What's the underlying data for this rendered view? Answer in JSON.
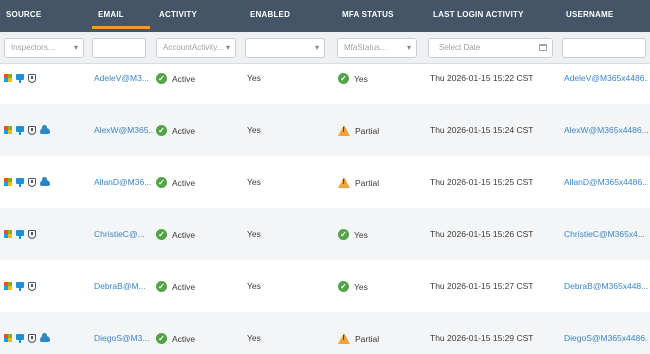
{
  "columns": {
    "source": "SOURCE",
    "email": "EMAIL",
    "activity": "ACTIVITY",
    "enabled": "ENABLED",
    "mfa": "MFA STATUS",
    "last_login": "LAST LOGIN ACTIVITY",
    "username": "USERNAME"
  },
  "filters": {
    "source": "Inspectors...",
    "email": "",
    "activity": "AccountActivity...",
    "enabled": "",
    "mfa": "MfaStatus...",
    "date": "Select Date",
    "username": ""
  },
  "colors": {
    "header_bg": "#435566",
    "active_tab": "#f39a2b",
    "link": "#3a86c8",
    "ok": "#52a447",
    "warn": "#f2a33a"
  },
  "rows": [
    {
      "icons": [
        "windows-icon",
        "monitor-icon",
        "shield-icon"
      ],
      "email": "AdeleV@M3...",
      "activity": "Active",
      "enabled": "Yes",
      "mfa": "Yes",
      "mfa_state": "ok",
      "last_login": "Thu 2026-01-15 15:22 CST",
      "username": "AdeleV@M365x4486..."
    },
    {
      "icons": [
        "windows-icon",
        "monitor-icon",
        "shield-icon",
        "cloud-icon"
      ],
      "email": "AlexW@M365...",
      "activity": "Active",
      "enabled": "Yes",
      "mfa": "Partial",
      "mfa_state": "warn",
      "last_login": "Thu 2026-01-15 15:24 CST",
      "username": "AlexW@M365x4486..."
    },
    {
      "icons": [
        "windows-icon",
        "monitor-icon",
        "shield-icon",
        "cloud-icon"
      ],
      "email": "AllanD@M36...",
      "activity": "Active",
      "enabled": "Yes",
      "mfa": "Partial",
      "mfa_state": "warn",
      "last_login": "Thu 2026-01-15 15:25 CST",
      "username": "AllanD@M365x4486..."
    },
    {
      "icons": [
        "windows-icon",
        "monitor-icon",
        "shield-icon"
      ],
      "email": "ChristieC@...",
      "activity": "Active",
      "enabled": "Yes",
      "mfa": "Yes",
      "mfa_state": "ok",
      "last_login": "Thu 2026-01-15 15:26 CST",
      "username": "ChristieC@M365x4..."
    },
    {
      "icons": [
        "windows-icon",
        "monitor-icon",
        "shield-icon"
      ],
      "email": "DebraB@M...",
      "activity": "Active",
      "enabled": "Yes",
      "mfa": "Yes",
      "mfa_state": "ok",
      "last_login": "Thu 2026-01-15 15:27 CST",
      "username": "DebraB@M365x448..."
    },
    {
      "icons": [
        "windows-icon",
        "monitor-icon",
        "shield-icon",
        "cloud-icon"
      ],
      "email": "DiegoS@M3...",
      "activity": "Active",
      "enabled": "Yes",
      "mfa": "Partial",
      "mfa_state": "warn",
      "last_login": "Thu 2026-01-15 15:29 CST",
      "username": "DiegoS@M365x4486..."
    }
  ]
}
